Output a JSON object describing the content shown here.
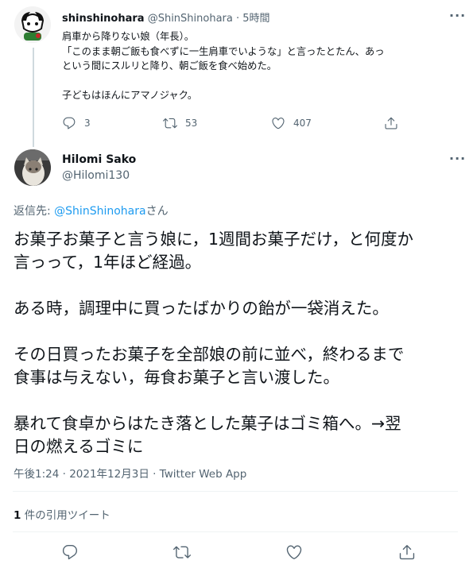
{
  "parent_tweet": {
    "display_name": "shinshinohara",
    "handle": "@ShinShinohara",
    "time": "5時間",
    "lines": [
      "肩車から降りない娘（年長）。",
      "「このまま朝ご飯も食べずに一生肩車でいような」と言ったとたん、あっ",
      "という間にスルリと降り、朝ご飯を食べ始めた。",
      "",
      "子どもはほんにアマノジャク。"
    ],
    "replies": "3",
    "retweets": "53",
    "likes": "407"
  },
  "main_tweet": {
    "display_name": "Hilomi Sako",
    "handle": "@Hilomi130",
    "reply_prefix": "返信先: ",
    "reply_to": "@ShinShinohara",
    "reply_suffix": "さん",
    "lines": [
      "お菓子お菓子と言う娘に，1週間お菓子だけ，と何度か",
      "言っって，1年ほど経過。",
      "",
      "ある時，調理中に買ったばかりの飴が一袋消えた。",
      "",
      "その日買ったお菓子を全部娘の前に並べ，終わるまで",
      "食事は与えない，毎食お菓子と言い渡した。",
      "",
      "暴れて食卓からはたき落とした菓子はゴミ箱へ。→翌",
      "日の燃えるゴミに"
    ],
    "timestamp": "午後1:24 · 2021年12月3日 · Twitter Web App",
    "quote_count": "1",
    "quote_label": " 件の引用ツイート"
  },
  "icons": {
    "more": "more-icon",
    "reply": "reply-icon",
    "retweet": "retweet-icon",
    "like": "like-icon",
    "share": "share-icon"
  },
  "colors": {
    "link": "#1d9bf0",
    "muted": "#536471",
    "divider": "#eff3f4",
    "thread_line": "#cfd9de"
  }
}
